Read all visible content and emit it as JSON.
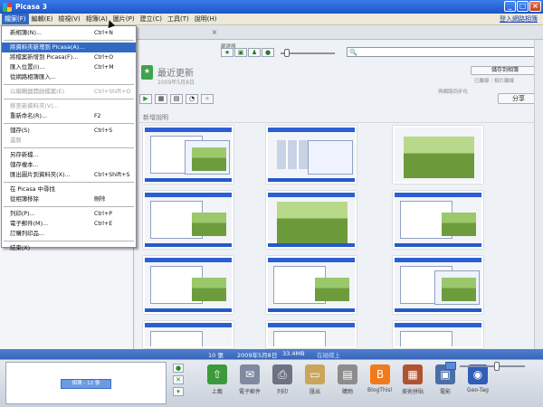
{
  "window": {
    "title": "Picasa 3",
    "min": "_",
    "max": "□",
    "close": "×"
  },
  "menubar": {
    "items": [
      "檔案(F)",
      "編輯(E)",
      "檢視(V)",
      "相簿(A)",
      "圖片(P)",
      "建立(C)",
      "工具(T)",
      "說明(H)"
    ],
    "signin": "登入網路相簿"
  },
  "file_menu": [
    {
      "label": "新相簿(N)...",
      "shortcut": "Ctrl+N",
      "state": "normal"
    },
    {
      "sep": true
    },
    {
      "label": "將資料夾新增到 Picasa(A)...",
      "shortcut": "",
      "state": "highlight"
    },
    {
      "label": "將檔案新增到 Picasa(F)...",
      "shortcut": "Ctrl+O",
      "state": "normal"
    },
    {
      "label": "匯入位置(I)...",
      "shortcut": "Ctrl+M",
      "state": "normal"
    },
    {
      "label": "從網路相簿匯入...",
      "shortcut": "",
      "state": "normal"
    },
    {
      "sep": true
    },
    {
      "label": "以編輯器開啟檔案(E)",
      "shortcut": "Ctrl+Shift+O",
      "state": "disabled"
    },
    {
      "sep": true
    },
    {
      "label": "移至新資料夾(V)...",
      "shortcut": "",
      "state": "disabled"
    },
    {
      "label": "重新命名(R)...",
      "shortcut": "F2",
      "state": "normal"
    },
    {
      "sep": true
    },
    {
      "label": "儲存(S)",
      "shortcut": "Ctrl+S",
      "state": "normal"
    },
    {
      "label": "還原",
      "shortcut": "",
      "state": "disabled"
    },
    {
      "sep": true
    },
    {
      "label": "另存新檔...",
      "shortcut": "",
      "state": "normal"
    },
    {
      "label": "儲存複本...",
      "shortcut": "",
      "state": "normal"
    },
    {
      "label": "匯出圖片到資料夾(X)...",
      "shortcut": "Ctrl+Shift+S",
      "state": "normal"
    },
    {
      "sep": true
    },
    {
      "label": "在 Picasa 中尋找",
      "shortcut": "",
      "state": "normal"
    },
    {
      "label": "從相簿移除",
      "shortcut": "刪除",
      "state": "normal"
    },
    {
      "sep": true
    },
    {
      "label": "列印(P)...",
      "shortcut": "Ctrl+P",
      "state": "normal"
    },
    {
      "label": "電子郵件(M)...",
      "shortcut": "Ctrl+E",
      "state": "normal"
    },
    {
      "label": "訂購列印品...",
      "shortcut": "",
      "state": "normal"
    },
    {
      "sep": true
    },
    {
      "label": "結束(X)",
      "shortcut": "",
      "state": "normal"
    }
  ],
  "content": {
    "tab_close": "×",
    "filter_label": "篩選器",
    "filters": [
      "★",
      "▣",
      "♟",
      "●"
    ],
    "search_icon": "🔍",
    "folder_title": "最近更新",
    "folder_date": "2009年5月8日",
    "save_album": "儲存到相簿",
    "offline": "已離線｜相片離線",
    "sync_label": "與網路同步化",
    "share": "分享",
    "actions": [
      "▶",
      "▦",
      "▤",
      "◔",
      "★"
    ],
    "caption": "新增說明"
  },
  "status": {
    "count": "10 張",
    "date": "2009年5月8日",
    "size": "33.4MB",
    "hidden": "在磁碟上"
  },
  "bottom": {
    "tray_label": "相簿 - 12 張",
    "tools": [
      {
        "label": "上載",
        "icon": "⇧",
        "color": "#3b9b3b"
      },
      {
        "label": "電子郵件",
        "icon": "✉",
        "color": "#7f8aa0"
      },
      {
        "label": "列印",
        "icon": "⎙",
        "color": "#6d7380"
      },
      {
        "label": "匯出",
        "icon": "▭",
        "color": "#c9a65a"
      },
      {
        "label": "購物",
        "icon": "▤",
        "color": "#8c8c8c"
      },
      {
        "label": "BlogThis!",
        "icon": "B",
        "color": "#f07a1c"
      },
      {
        "label": "美術拼貼",
        "icon": "▦",
        "color": "#b0542f"
      },
      {
        "label": "電影",
        "icon": "▣",
        "color": "#4a6fa8"
      },
      {
        "label": "Geo-Tag",
        "icon": "◉",
        "color": "#2f5db8"
      }
    ]
  }
}
